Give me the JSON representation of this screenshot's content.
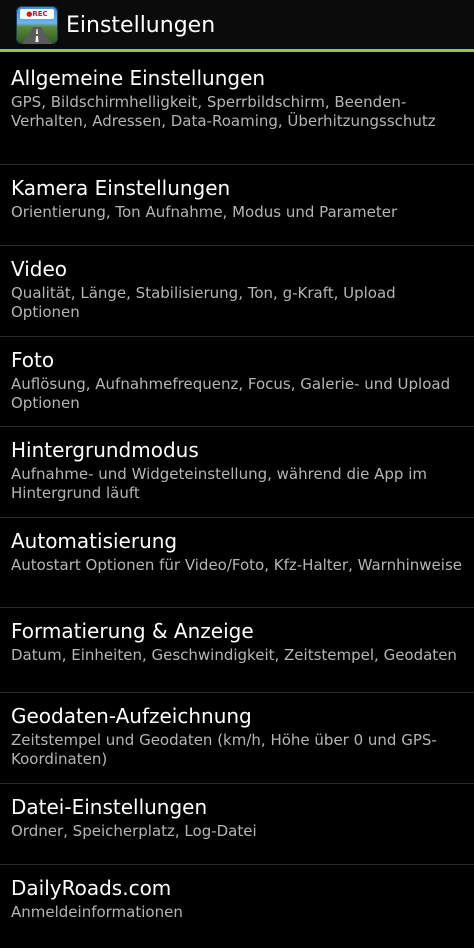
{
  "action_bar": {
    "icon_badge": "●REC",
    "title": "Einstellungen"
  },
  "settings": [
    {
      "title": "Allgemeine Einstellungen",
      "summary": "GPS, Bildschirmhelligkeit, Sperrbildschirm, Beenden-Verhalten, Adressen, Data-Roaming, Überhitzungsschutz"
    },
    {
      "title": "Kamera Einstellungen",
      "summary": "Orientierung, Ton Aufnahme, Modus und Parameter"
    },
    {
      "title": "Video",
      "summary": "Qualität, Länge, Stabilisierung, Ton, g-Kraft, Upload Optionen"
    },
    {
      "title": "Foto",
      "summary": "Auflösung, Aufnahmefrequenz, Focus, Galerie- und Upload Optionen"
    },
    {
      "title": "Hintergrundmodus",
      "summary": "Aufnahme- und Widgeteinstellung, während die App im Hintergrund läuft"
    },
    {
      "title": "Automatisierung",
      "summary": "Autostart Optionen für Video/Foto, Kfz-Halter, Warnhinweise"
    },
    {
      "title": "Formatierung & Anzeige",
      "summary": "Datum, Einheiten, Geschwindigkeit, Zeitstempel, Geodaten"
    },
    {
      "title": "Geodaten-Aufzeichnung",
      "summary": "Zeitstempel und Geodaten (km/h, Höhe über 0 und GPS-Koordinaten)"
    },
    {
      "title": "Datei-Einstellungen",
      "summary": "Ordner, Speicherplatz, Log-Datei"
    },
    {
      "title": "DailyRoads.com",
      "summary": "Anmeldeinformationen"
    }
  ],
  "colors": {
    "accent": "#92c83e",
    "background": "#000000",
    "summary_text": "#b5b5b5"
  }
}
